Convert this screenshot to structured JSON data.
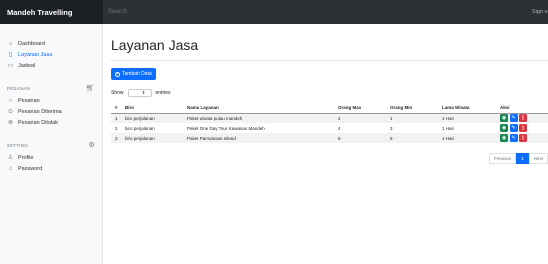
{
  "topbar": {
    "brand": "Mandeh Travelling",
    "search_placeholder": "Search",
    "signout": "Sign out"
  },
  "sidebar": {
    "items": [
      {
        "label": "Dashboard",
        "icon": "home-icon"
      },
      {
        "label": "Layanan Jasa",
        "icon": "file-icon",
        "active": true
      },
      {
        "label": "Jadwal",
        "icon": "calendar-icon"
      }
    ],
    "pesanan_heading": "PESANAN",
    "pesanan_items": [
      {
        "label": "Pesanan",
        "icon": "circle-icon"
      },
      {
        "label": "Pesanan Diterima",
        "icon": "check-circle-icon"
      },
      {
        "label": "Pesanan Ditolak",
        "icon": "x-circle-icon"
      }
    ],
    "setting_heading": "SETTING",
    "setting_items": [
      {
        "label": "Profile",
        "icon": "user-icon"
      },
      {
        "label": "Password",
        "icon": "lock-icon"
      }
    ]
  },
  "main": {
    "title": "Layanan Jasa",
    "add_button": "Tambah Data",
    "show_label": "Show",
    "entries_label": "entries",
    "entries_value": "10"
  },
  "table": {
    "columns": [
      "#",
      "Biro",
      "Nama Layanan",
      "Orang Max",
      "Orang Min",
      "Lama Wisata",
      "Aksi"
    ],
    "rows": [
      [
        "1",
        "biro perjalanan",
        "Paket wisata pulau mandeh",
        "2",
        "1",
        "1 Hari"
      ],
      [
        "2",
        "biro perjalanan",
        "Paket One Day Tour Kawasan Mandeh",
        "4",
        "3",
        "1 Hari"
      ],
      [
        "3",
        "biro perjalanan",
        "Paket Pamutusan Island",
        "6",
        "5",
        "1 Hari"
      ]
    ]
  },
  "pagination": {
    "previous": "Previous",
    "page": "1",
    "next": "Next"
  },
  "colors": {
    "primary": "#0d6efd",
    "success": "#198754",
    "danger": "#dc3545",
    "topbar": "#212529"
  }
}
